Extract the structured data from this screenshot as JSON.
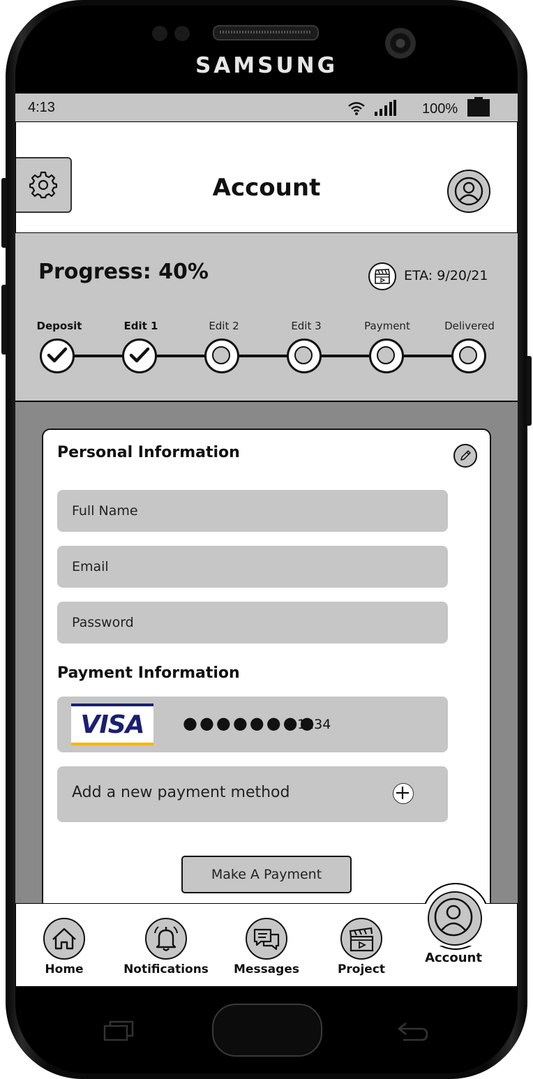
{
  "device": {
    "brand": "SAMSUNG"
  },
  "status_bar": {
    "time": "4:13",
    "battery": "100%"
  },
  "header": {
    "title": "Account"
  },
  "progress": {
    "label": "Progress:  40%",
    "percent": 40,
    "eta": "ETA: 9/20/21",
    "steps": [
      {
        "label": "Deposit",
        "done": true
      },
      {
        "label": "Edit 1",
        "done": true
      },
      {
        "label": "Edit 2",
        "done": false
      },
      {
        "label": "Edit 3",
        "done": false
      },
      {
        "label": "Payment",
        "done": false
      },
      {
        "label": "Delivered",
        "done": false
      }
    ]
  },
  "personal": {
    "title": "Personal Information",
    "full_name_placeholder": "Full Name",
    "email_placeholder": "Email",
    "password_placeholder": "Password"
  },
  "payment": {
    "title": "Payment Information",
    "card_brand": "VISA",
    "masked": "●●●●●●●●",
    "last4": "1234",
    "add_method": "Add a new payment method",
    "make_payment": "Make A Payment"
  },
  "nav": {
    "items": [
      {
        "label": "Home",
        "icon": "home-icon"
      },
      {
        "label": "Notifications",
        "icon": "bell-icon"
      },
      {
        "label": "Messages",
        "icon": "chat-icon"
      },
      {
        "label": "Project",
        "icon": "clapperboard-icon"
      },
      {
        "label": "Account",
        "icon": "user-icon",
        "active": true
      }
    ]
  }
}
